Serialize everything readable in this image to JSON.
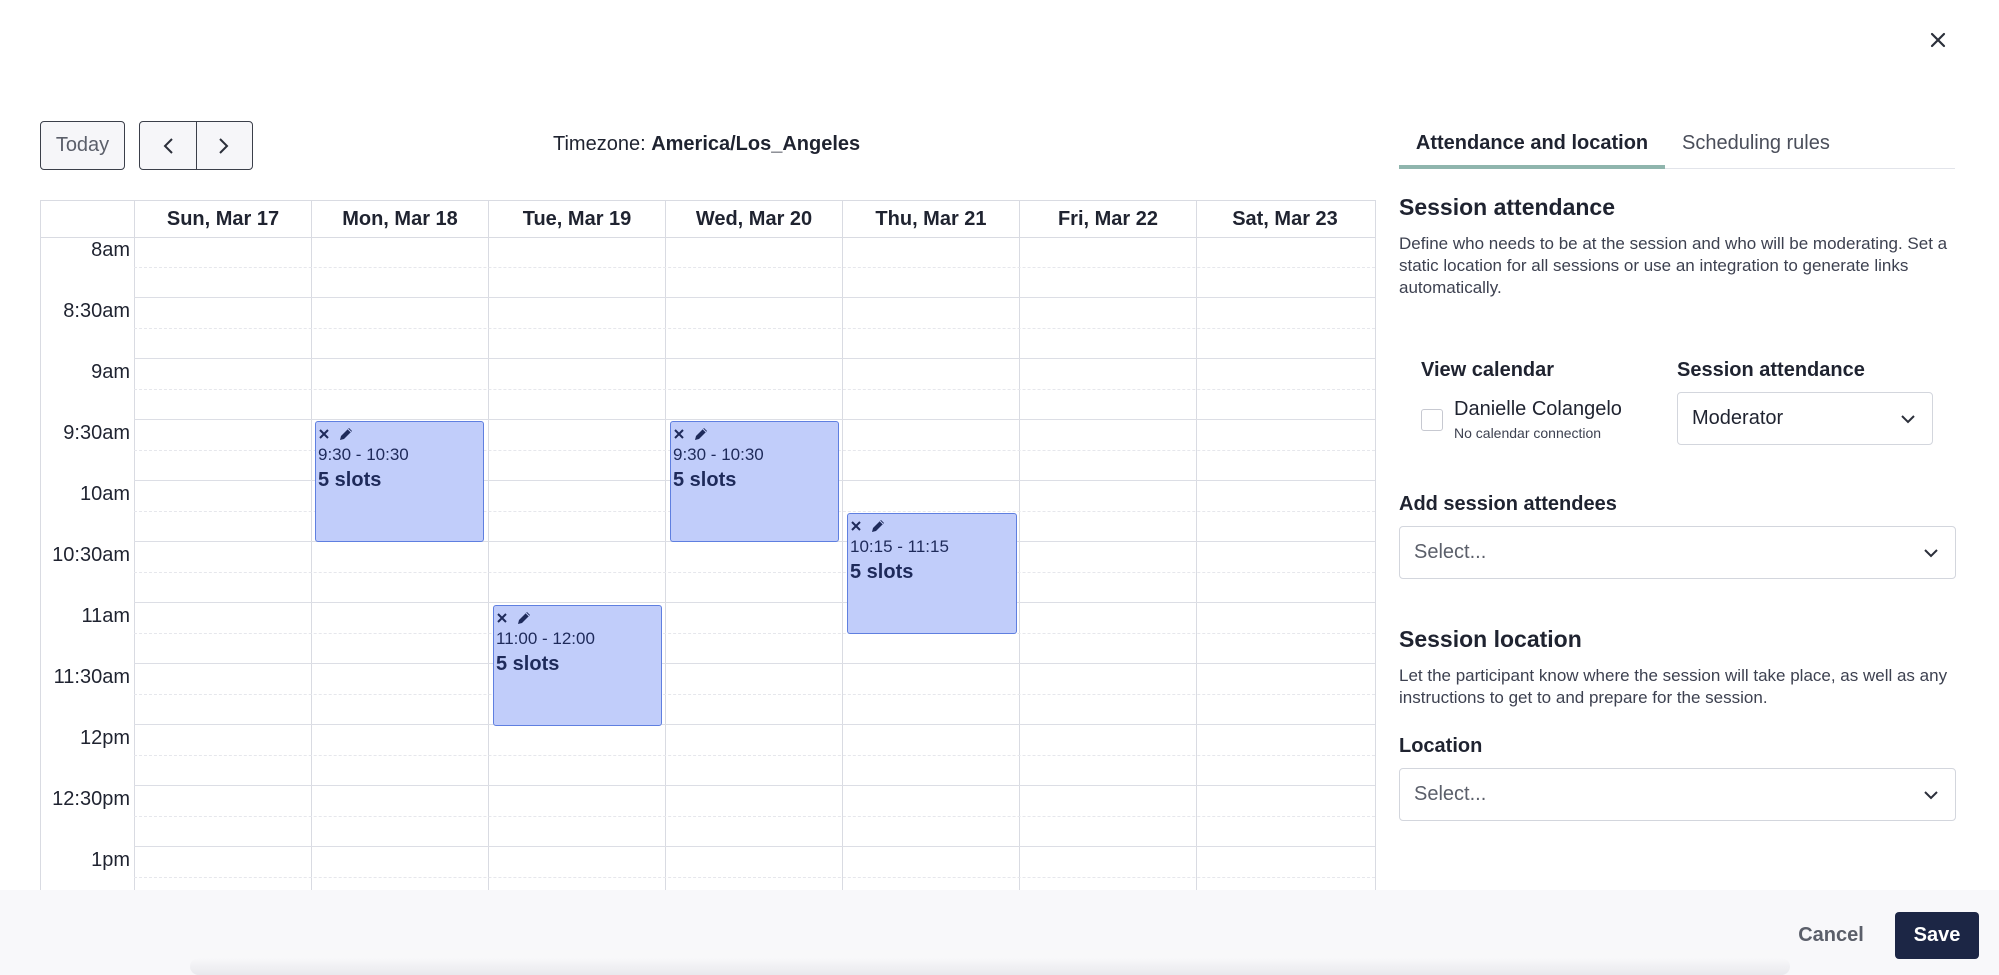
{
  "toolbar": {
    "today_label": "Today",
    "timezone_label": "Timezone: ",
    "timezone_value": "America/Los_Angeles"
  },
  "calendar": {
    "days": [
      "Sun, Mar 17",
      "Mon, Mar 18",
      "Tue, Mar 19",
      "Wed, Mar 20",
      "Thu, Mar 21",
      "Fri, Mar 22",
      "Sat, Mar 23"
    ],
    "times": [
      "8am",
      "8:30am",
      "9am",
      "9:30am",
      "10am",
      "10:30am",
      "11am",
      "11:30am",
      "12pm",
      "12:30pm",
      "1pm"
    ],
    "events": [
      {
        "time": "9:30 - 10:30",
        "slots": "5 slots"
      },
      {
        "time": "9:30 - 10:30",
        "slots": "5 slots"
      },
      {
        "time": "11:00 - 12:00",
        "slots": "5 slots"
      },
      {
        "time": "10:15 - 11:15",
        "slots": "5 slots"
      }
    ],
    "event_color": "#c1cdfa"
  },
  "panel": {
    "tabs": [
      "Attendance and location",
      "Scheduling rules"
    ],
    "attendance": {
      "title": "Session attendance",
      "description": "Define who needs to be at the session and who will be moderating. Set a static location for all sessions or use an integration to generate links automatically.",
      "view_calendar_label": "View calendar",
      "attendance_label": "Session attendance",
      "person_name": "Danielle Colangelo",
      "person_sub": "No calendar connection",
      "role_value": "Moderator",
      "add_attendees_label": "Add session attendees",
      "add_attendees_placeholder": "Select..."
    },
    "location": {
      "title": "Session location",
      "description": "Let the participant know where the session will take place, as well as any instructions to get to and prepare for the session.",
      "location_label": "Location",
      "location_placeholder": "Select..."
    }
  },
  "footer": {
    "cancel_label": "Cancel",
    "save_label": "Save",
    "save_color": "#1c2645"
  }
}
